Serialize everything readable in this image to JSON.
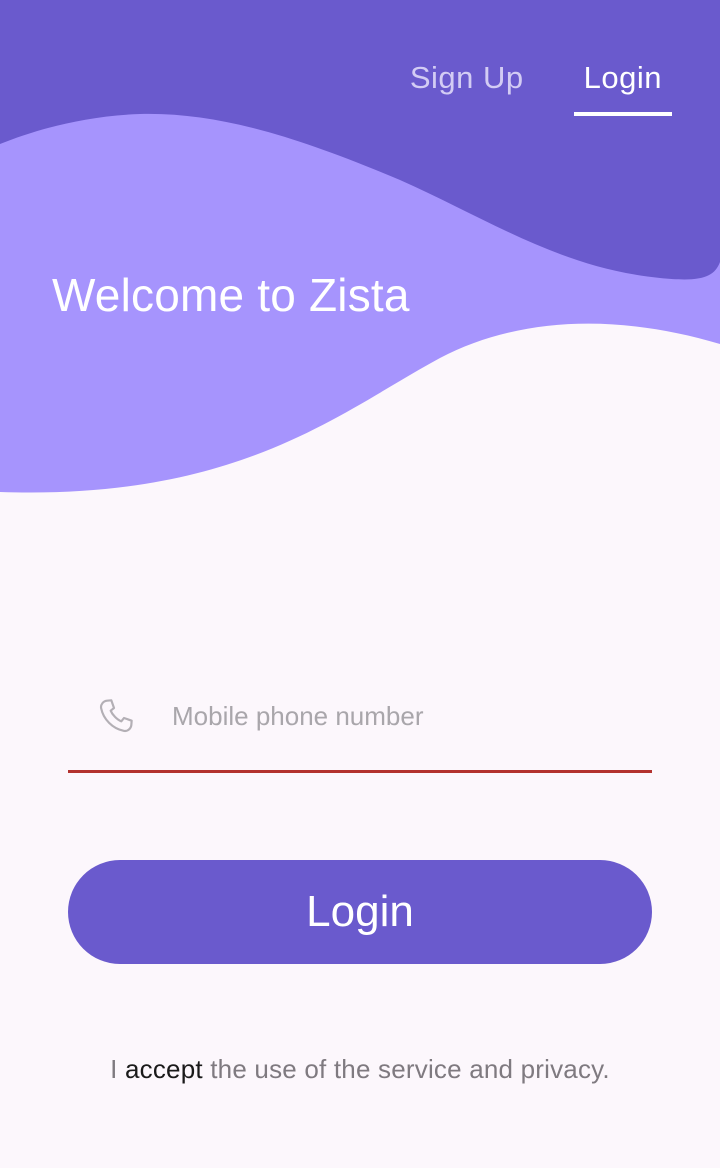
{
  "colors": {
    "dark_purple": "#6a5acd",
    "light_purple": "#a694fd",
    "background": "#fcf7fc",
    "field_underline": "#b3322f"
  },
  "tabs": {
    "signup_label": "Sign Up",
    "login_label": "Login",
    "active": "Login"
  },
  "welcome_title": "Welcome to Zista",
  "phone_field": {
    "icon": "phone-icon",
    "placeholder": "Mobile phone number",
    "value": ""
  },
  "login_button_label": "Login",
  "terms": {
    "prefix": "I ",
    "accept_link": "accept",
    "suffix": " the use of the service and privacy."
  }
}
